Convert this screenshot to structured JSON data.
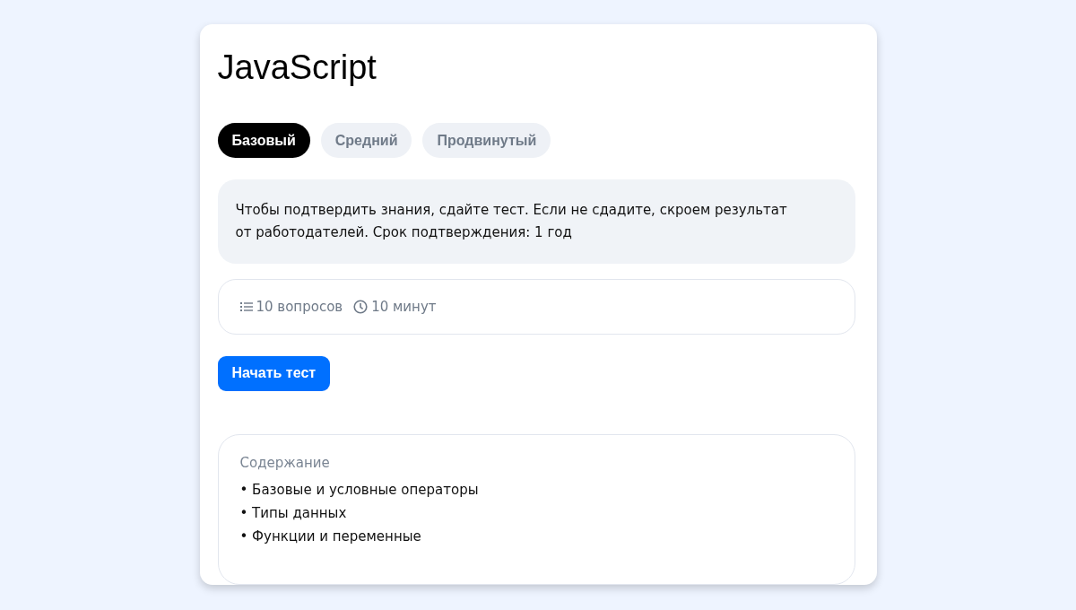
{
  "title": "JavaScript",
  "tabs": [
    {
      "label": "Базовый",
      "selected": true
    },
    {
      "label": "Средний",
      "selected": false
    },
    {
      "label": "Продвинутый",
      "selected": false
    }
  ],
  "notice": "Чтобы подтвердить знания, сдайте тест. Если не сдадите, скроем результат от работодателей. Срок подтверждения: 1 год",
  "stats": [
    {
      "kind": "list",
      "text": "10 вопросов"
    },
    {
      "kind": "clock",
      "text": "10 минут"
    }
  ],
  "start_button": "Начать тест",
  "contents": {
    "heading": "Содержание",
    "items": [
      "• Базовые и условные операторы",
      "• Типы данных",
      "• Функции и переменные"
    ]
  }
}
